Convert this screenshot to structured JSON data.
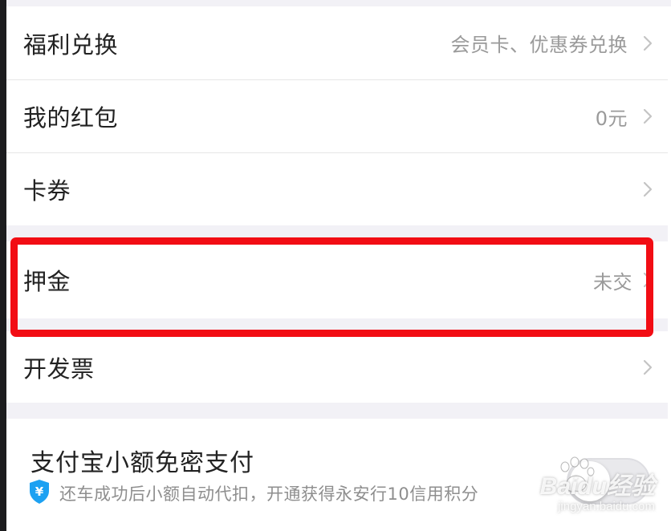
{
  "menu": {
    "items": [
      {
        "label": "福利兑换",
        "value": "会员卡、优惠券兑换"
      },
      {
        "label": "我的红包",
        "value": "0元"
      },
      {
        "label": "卡券",
        "value": ""
      },
      {
        "label": "押金",
        "value": "未交"
      },
      {
        "label": "开发票",
        "value": ""
      }
    ]
  },
  "payment": {
    "title": "支付宝小额免密支付",
    "subtitle": "还车成功后小额自动代扣，开通获得永安行10信用积分",
    "shield_symbol": "¥",
    "toggle_on": false
  },
  "annotation": {
    "highlight_color": "#f20d14"
  },
  "watermark": {
    "brand": "Baidu经验",
    "url": "jingyan.baidu.com"
  },
  "icons": {
    "chevron": "chevron-right-icon",
    "shield": "shield-yuan-icon"
  }
}
